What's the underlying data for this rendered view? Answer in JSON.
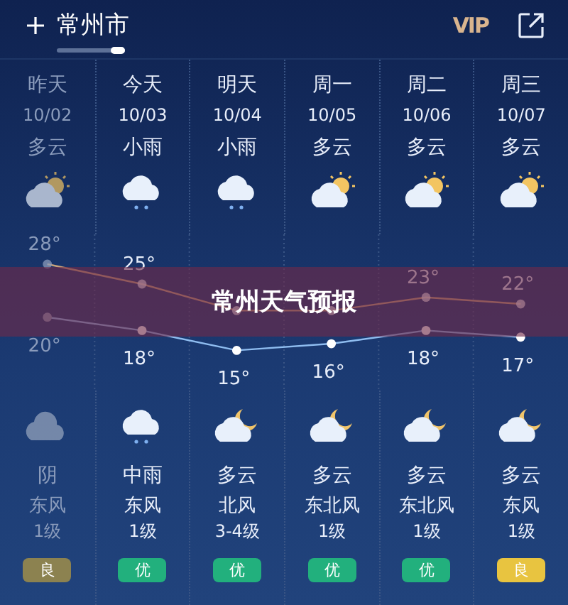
{
  "header": {
    "city": "常州市",
    "vip": "VIP"
  },
  "days": [
    {
      "day": "昨天",
      "date": "10/02",
      "day_weather": "多云",
      "day_icon": {
        "kind": "partly_cloudy"
      },
      "night_icon": {
        "kind": "overcast"
      },
      "night_weather": "阴",
      "wind": "东风",
      "wind_level": "1级",
      "aqi": "良",
      "color": "#8c8250",
      "dimmed": true
    },
    {
      "day": "今天",
      "date": "10/03",
      "day_weather": "小雨",
      "day_icon": {
        "kind": "rain"
      },
      "night_icon": {
        "kind": "rain"
      },
      "night_weather": "中雨",
      "wind": "东风",
      "wind_level": "1级",
      "aqi": "优",
      "color": "#22b07d",
      "dimmed": false
    },
    {
      "day": "明天",
      "date": "10/04",
      "day_weather": "小雨",
      "day_icon": {
        "kind": "rain"
      },
      "night_icon": {
        "kind": "moon_cloud"
      },
      "night_weather": "多云",
      "wind": "北风",
      "wind_level": "3-4级",
      "aqi": "优",
      "color": "#22b07d",
      "dimmed": false
    },
    {
      "day": "周一",
      "date": "10/05",
      "day_weather": "多云",
      "day_icon": {
        "kind": "partly_cloudy"
      },
      "night_icon": {
        "kind": "moon_cloud"
      },
      "night_weather": "多云",
      "wind": "东北风",
      "wind_level": "1级",
      "aqi": "优",
      "color": "#22b07d",
      "dimmed": false
    },
    {
      "day": "周二",
      "date": "10/06",
      "day_weather": "多云",
      "day_icon": {
        "kind": "partly_cloudy"
      },
      "night_icon": {
        "kind": "moon_cloud"
      },
      "night_weather": "多云",
      "wind": "东北风",
      "wind_level": "1级",
      "aqi": "优",
      "color": "#22b07d",
      "dimmed": false
    },
    {
      "day": "周三",
      "date": "10/07",
      "day_weather": "多云",
      "day_icon": {
        "kind": "partly_cloudy"
      },
      "night_icon": {
        "kind": "moon_cloud"
      },
      "night_weather": "多云",
      "wind": "东风",
      "wind_level": "1级",
      "aqi": "良",
      "color": "#e8c440",
      "dimmed": false
    }
  ],
  "chart_data": {
    "type": "line",
    "data_labels": true,
    "series": [
      {
        "color": "#c9a27a",
        "marker": true,
        "values": [
          28,
          25,
          21,
          21,
          23,
          22
        ],
        "value_labels": [
          "28°",
          "25°",
          null,
          null,
          "23°",
          "22°"
        ]
      },
      {
        "color": "#8fbdf0",
        "marker": true,
        "values": [
          20,
          18,
          15,
          16,
          18,
          17
        ],
        "value_labels": [
          "20°",
          "18°",
          "15°",
          "16°",
          "18°",
          "17°"
        ]
      }
    ]
  },
  "banner": {
    "text": "常州天气预报"
  }
}
